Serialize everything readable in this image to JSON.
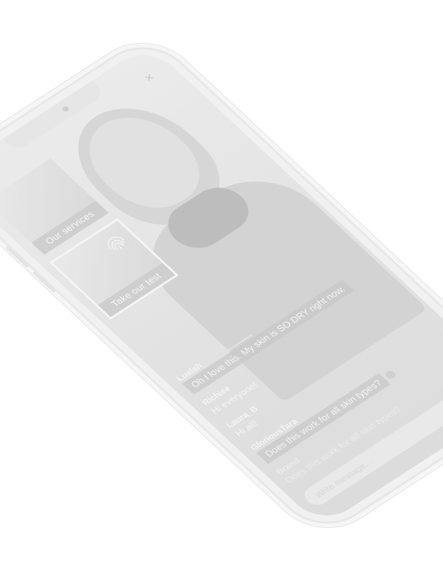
{
  "window": {
    "close_glyph": "×"
  },
  "cards": [
    {
      "label": "Our services",
      "icon": "image"
    },
    {
      "label": "Take our test",
      "icon": "fingerprint-icon"
    }
  ],
  "chat": {
    "messages": [
      {
        "user": "Lualah",
        "text": "Oh I love this. My skin is SO DRY right now."
      },
      {
        "user": "Richiee",
        "text": "Hi everyone!"
      },
      {
        "user": "Laura_B",
        "text": "Hi all!"
      },
      {
        "user": "GloriousTara",
        "text": "Does this work for all skin types?"
      },
      {
        "user": "Brand",
        "text": "Does this work for all skin types?"
      }
    ],
    "composer_placeholder": "Write message..."
  },
  "colors": {
    "background": "#ffffff",
    "frame": "#f1f1f1",
    "screen": "#ececec"
  }
}
